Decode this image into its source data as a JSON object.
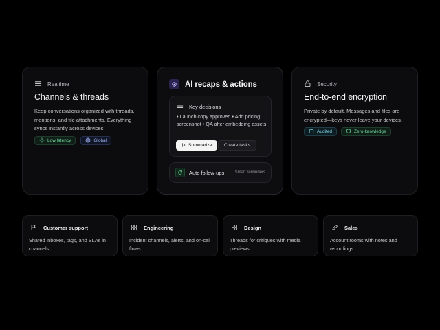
{
  "cards": {
    "realtime": {
      "eyebrow": "Realtime",
      "title": "Channels & threads",
      "description": "Keep conversations organized with threads, mentions, and file attachments. Everything syncs instantly across devices.",
      "badges": [
        "Low latency",
        "Global"
      ]
    },
    "ai": {
      "title": "AI recaps & actions",
      "decisions": {
        "heading": "Key decisions",
        "text": "• Launch copy approved • Add pricing screenshot • QA after embedding assets",
        "summarize": "Summarize",
        "create_tasks": "Create tasks"
      },
      "followups": {
        "label": "Auto follow-ups",
        "hint": "Smart reminders"
      }
    },
    "security": {
      "eyebrow": "Security",
      "title": "End-to-end encryption",
      "description": "Private by default. Messages and files are encrypted—keys never leave your devices.",
      "badges": [
        "Audited",
        "Zero-knowledge"
      ]
    }
  },
  "use_cases": [
    {
      "title": "Customer support",
      "description": "Shared inboxes, tags, and SLAs in channels.",
      "icon": "flag-icon"
    },
    {
      "title": "Engineering",
      "description": "Incident channels, alerts, and on-call flows.",
      "icon": "grid-icon"
    },
    {
      "title": "Design",
      "description": "Threads for critiques with media previews.",
      "icon": "grid-icon"
    },
    {
      "title": "Sales",
      "description": "Account rooms with notes and recordings.",
      "icon": "pen-icon"
    }
  ],
  "colors": {
    "background": "#000000",
    "card": "#0c0c0e",
    "accent_green": "#6fd49a",
    "accent_blue": "#9fb0f0",
    "accent_cyan": "#7fd3e6"
  }
}
